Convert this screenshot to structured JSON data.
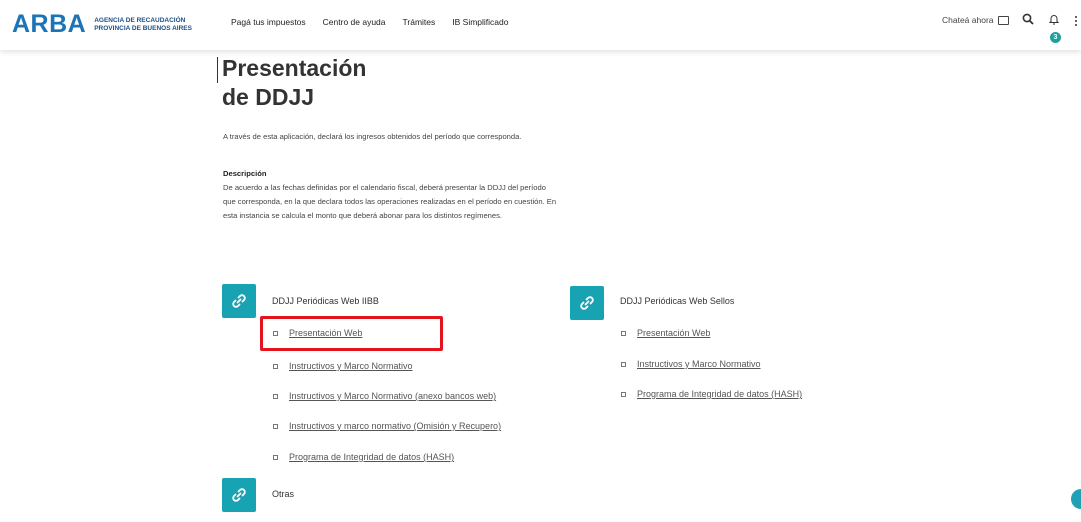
{
  "header": {
    "logo_mark": "ARBA",
    "logo_line1": "AGENCIA DE RECAUDACIÓN",
    "logo_line2": "PROVINCIA DE BUENOS AIRES",
    "nav": [
      "Pagá tus impuestos",
      "Centro de ayuda",
      "Trámites",
      "IB Simplificado"
    ],
    "chat_label": "Chateá ahora",
    "notifications_count": "3"
  },
  "main": {
    "title_line1": "Presentación",
    "title_line2": "de DDJJ",
    "intro": "A través de esta aplicación, declará los ingresos obtenidos del período que corresponda.",
    "description_heading": "Descripción",
    "description_body": "De acuerdo a las fechas definidas por el calendario fiscal, deberá presentar la DDJJ del período que corresponda, en la que declara todos las operaciones realizadas en el período en cuestión. En esta instancia se calcula el monto que deberá abonar para los distintos regímenes."
  },
  "sections": {
    "iibb": {
      "title": "DDJJ Periódicas Web IIBB",
      "links": [
        "Presentación Web",
        "Instructivos y Marco Normativo",
        "Instructivos y Marco Normativo (anexo bancos web)",
        "Instructivos y marco normativo (Omisión y Recupero)",
        "Programa de Integridad de datos (HASH)"
      ]
    },
    "sellos": {
      "title": "DDJJ Periódicas Web Sellos",
      "links": [
        "Presentación Web",
        "Instructivos y Marco Normativo",
        "Programa de Integridad de datos (HASH)"
      ]
    },
    "otras": {
      "title": "Otras"
    }
  },
  "colors": {
    "brand_blue": "#1a74b6",
    "accent_teal": "#18a3b3",
    "highlight_red": "#e3141b"
  },
  "icons": [
    "chat-icon",
    "search-icon",
    "bell-icon",
    "kebab-icon",
    "link-icon"
  ]
}
